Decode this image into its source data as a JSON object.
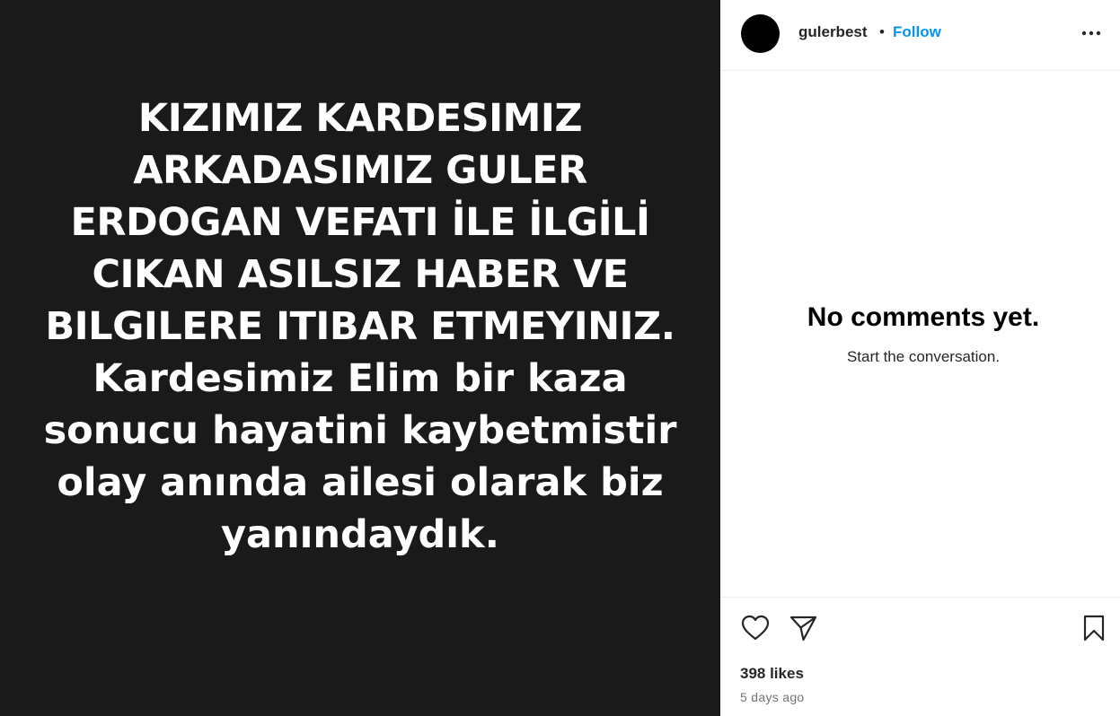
{
  "media": {
    "lines": [
      "KIZIMIZ KARDESIMIZ",
      "ARKADASIMIZ GULER",
      "ERDOGAN VEFATI İLE İLGİLİ",
      "CIKAN ASILSIZ HABER VE",
      "BILGILERE ITIBAR ETMEYINIZ.",
      "Kardesimiz Elim bir kaza",
      "sonucu hayatini kaybetmistir",
      "olay anında ailesi olarak biz",
      "yanındaydık."
    ],
    "background_color": "#1a1a1a",
    "text_color": "#ffffff"
  },
  "header": {
    "username": "gulerbest",
    "separator": "•",
    "follow_label": "Follow",
    "follow_color": "#0095f6",
    "more_icon": "more-horizontal-icon"
  },
  "comments": {
    "empty_title": "No comments yet.",
    "empty_subtitle": "Start the conversation."
  },
  "actions": {
    "like_icon": "heart-icon",
    "share_icon": "paper-plane-icon",
    "save_icon": "bookmark-icon"
  },
  "stats": {
    "likes": "398 likes",
    "time_ago": "5 days ago"
  }
}
